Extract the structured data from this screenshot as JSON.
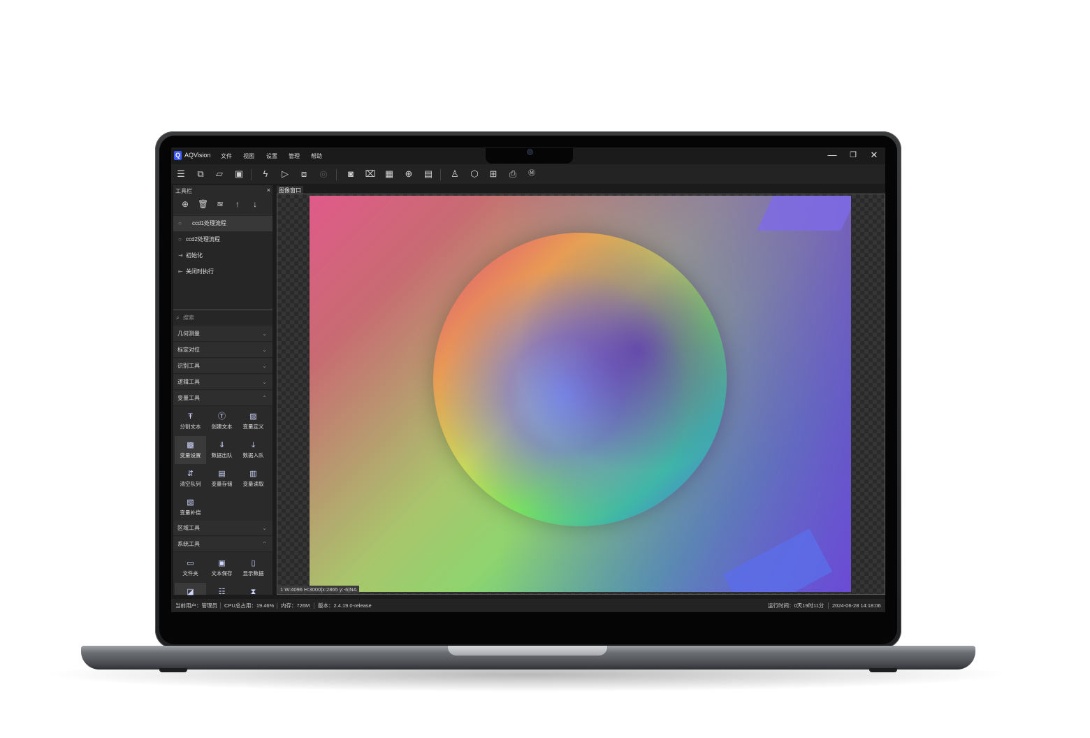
{
  "app": {
    "logo_letter": "Q",
    "name": "AQVision",
    "menu": [
      "文件",
      "视图",
      "设置",
      "管理",
      "帮助"
    ],
    "window_controls": {
      "minimize": "—",
      "restore": "❐",
      "close": "✕"
    }
  },
  "toolbar_icons": [
    "list-icon",
    "copy-icon",
    "folder-open-icon",
    "save-icon",
    "flash-icon",
    "play-icon",
    "layers-icon",
    "disabled-icon",
    "camera-icon",
    "trash-icon",
    "chip-icon",
    "target-icon",
    "calendar-icon",
    "user-icon",
    "cube-icon",
    "table-icon",
    "printer-icon",
    "m-icon"
  ],
  "panel": {
    "title": "工具栏",
    "close": "×",
    "flows": [
      {
        "label": "ccd1处理流程",
        "icon": "○",
        "selected": true
      },
      {
        "label": "ccd2处理流程",
        "icon": "○",
        "selected": false
      },
      {
        "label": "初始化",
        "icon": "⇥",
        "selected": false
      },
      {
        "label": "关闭时执行",
        "icon": "⇤",
        "selected": false
      }
    ],
    "search_placeholder": "搜索",
    "categories": {
      "geo": "几何测量",
      "calib": "标定对位",
      "recog": "识别工具",
      "logic": "逻辑工具",
      "var": "变量工具",
      "region": "区域工具",
      "system": "系统工具"
    },
    "var_tools": [
      "分割文本",
      "创建文本",
      "变量定义",
      "变量设置",
      "数据出队",
      "数据入队",
      "清空队列",
      "变量存储",
      "变量读取",
      "变量补偿"
    ],
    "system_tools": [
      "文件夹",
      "文本保存",
      "显示数据"
    ]
  },
  "image_window": {
    "tab": "图像窗口",
    "pixel_info": "1 W:4096 H:3000|x:2865 y:-6|NA"
  },
  "status": {
    "user": "当前用户：管理员",
    "cpu": "CPU总占用：19.46%",
    "memory": "内存：726M",
    "version": "版本：2.4.19.0-release",
    "runtime": "运行时间：0天19时11分",
    "datetime": "2024-06-28 14:18:06"
  }
}
